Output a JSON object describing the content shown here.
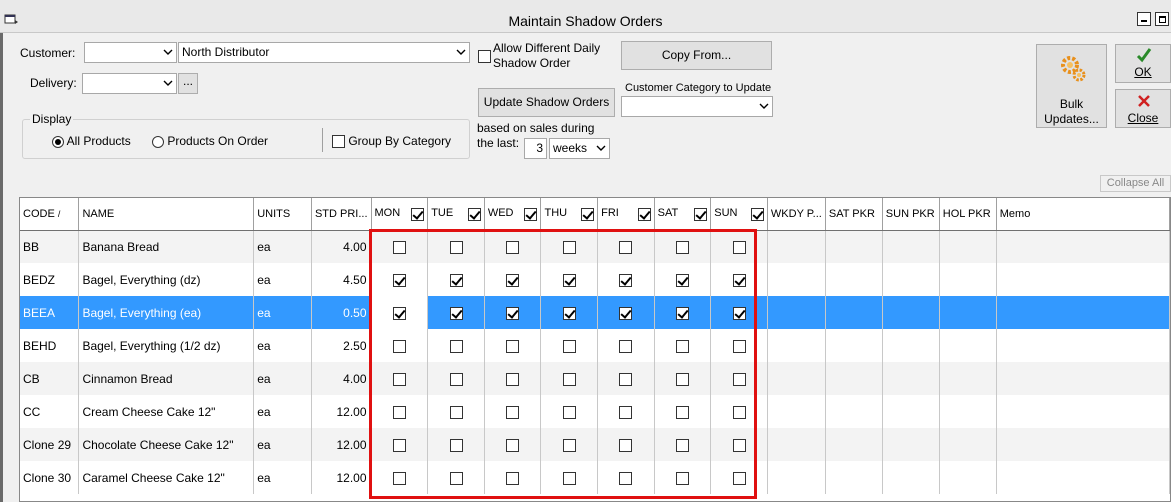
{
  "window": {
    "title": "Maintain Shadow Orders"
  },
  "form": {
    "customer_label": "Customer:",
    "customer_code": "",
    "customer_name": "North Distributor",
    "delivery_label": "Delivery:",
    "delivery_value": "",
    "browse_label": "...",
    "allow_daily_label_1": "Allow Different Daily",
    "allow_daily_label_2": "Shadow Order",
    "allow_daily_checked": false,
    "copy_from_label": "Copy From...",
    "update_shadow_label": "Update Shadow Orders",
    "category_label": "Customer Category to Update",
    "category_value": "",
    "based_on_1": "based on sales during",
    "based_on_2": "the last:",
    "weeks_count": "3",
    "weeks_unit": "weeks",
    "bulk_label_1": "Bulk",
    "bulk_label_2": "Updates...",
    "ok_label": "OK",
    "close_label": "Close",
    "display_label": "Display",
    "all_products_label": "All Products",
    "on_order_label": "Products On Order",
    "group_by_label": "Group By Category",
    "collapse_all_label": "Collapse All"
  },
  "grid": {
    "headers": {
      "code": "CODE",
      "sort_indicator": "/",
      "name": "NAME",
      "units": "UNITS",
      "std_price": "STD PRI...",
      "mon": "MON",
      "tue": "TUE",
      "wed": "WED",
      "thu": "THU",
      "fri": "FRI",
      "sat": "SAT",
      "sun": "SUN",
      "wkdy": "WKDY P...",
      "sat_pkr": "SAT PKR",
      "sun_pkr": "SUN PKR",
      "hol_pkr": "HOL PKR",
      "memo": "Memo"
    },
    "rows": [
      {
        "code": "BB",
        "name": "Banana Bread",
        "units": "ea",
        "price": "4.00",
        "days": [
          false,
          false,
          false,
          false,
          false,
          false,
          false
        ]
      },
      {
        "code": "BEDZ",
        "name": "Bagel, Everything (dz)",
        "units": "ea",
        "price": "4.50",
        "days": [
          true,
          true,
          true,
          true,
          true,
          true,
          true
        ]
      },
      {
        "code": "BEEA",
        "name": "Bagel, Everything (ea)",
        "units": "ea",
        "price": "0.50",
        "days": [
          true,
          true,
          true,
          true,
          true,
          true,
          true
        ],
        "selected": true
      },
      {
        "code": "BEHD",
        "name": "Bagel, Everything (1/2 dz)",
        "units": "ea",
        "price": "2.50",
        "days": [
          false,
          false,
          false,
          false,
          false,
          false,
          false
        ]
      },
      {
        "code": "CB",
        "name": "Cinnamon Bread",
        "units": "ea",
        "price": "4.00",
        "days": [
          false,
          false,
          false,
          false,
          false,
          false,
          false
        ]
      },
      {
        "code": "CC",
        "name": "Cream Cheese Cake 12\"",
        "units": "ea",
        "price": "12.00",
        "days": [
          false,
          false,
          false,
          false,
          false,
          false,
          false
        ]
      },
      {
        "code": "Clone 29",
        "name": "Chocolate Cheese Cake 12\"",
        "units": "ea",
        "price": "12.00",
        "days": [
          false,
          false,
          false,
          false,
          false,
          false,
          false
        ]
      },
      {
        "code": "Clone 30",
        "name": "Caramel Cheese Cake 12\"",
        "units": "ea",
        "price": "12.00",
        "days": [
          false,
          false,
          false,
          false,
          false,
          false,
          false
        ]
      }
    ]
  },
  "colors": {
    "selection": "#3399ff",
    "highlight_box": "#e01010",
    "gear": "#f0a030",
    "ok_check": "#2a8a2a",
    "close_x": "#d02020"
  },
  "icons": [
    "app-icon",
    "minimize-icon",
    "restore-icon",
    "gear-icon",
    "check-icon",
    "close-x-icon",
    "chevron-down-icon"
  ]
}
